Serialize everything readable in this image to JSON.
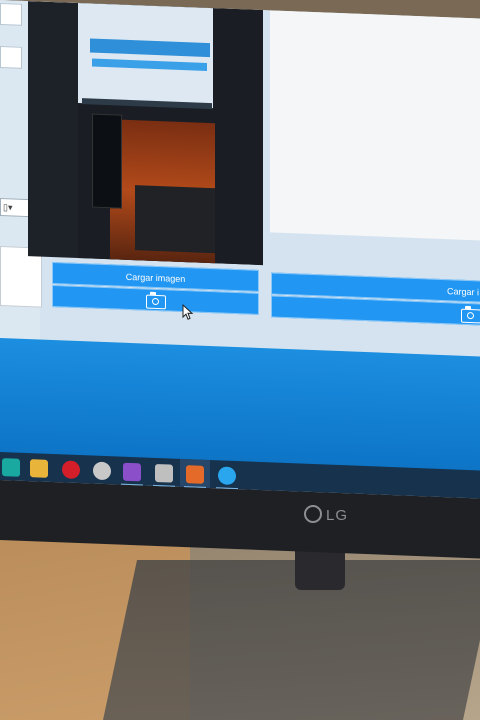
{
  "app": {
    "left_button_label": "Cargar imagen",
    "right_button_label": "Cargar i",
    "camera_icon": "camera-icon"
  },
  "taskbar": {
    "items": [
      {
        "name": "edge-icon",
        "color": "#1aa9a0"
      },
      {
        "name": "file-explorer-icon",
        "color": "#e8b43a"
      },
      {
        "name": "opera-icon",
        "color": "#d41e2a"
      },
      {
        "name": "fish-app-icon",
        "color": "#c8c8c8"
      },
      {
        "name": "visual-studio-icon",
        "color": "#8a4fc9"
      },
      {
        "name": "scanner-icon",
        "color": "#bfbfbf"
      },
      {
        "name": "tile-app-icon",
        "color": "#e46a2a"
      },
      {
        "name": "blue-circle-app-icon",
        "color": "#2aa6ee"
      }
    ]
  },
  "monitor": {
    "brand": "LG"
  }
}
